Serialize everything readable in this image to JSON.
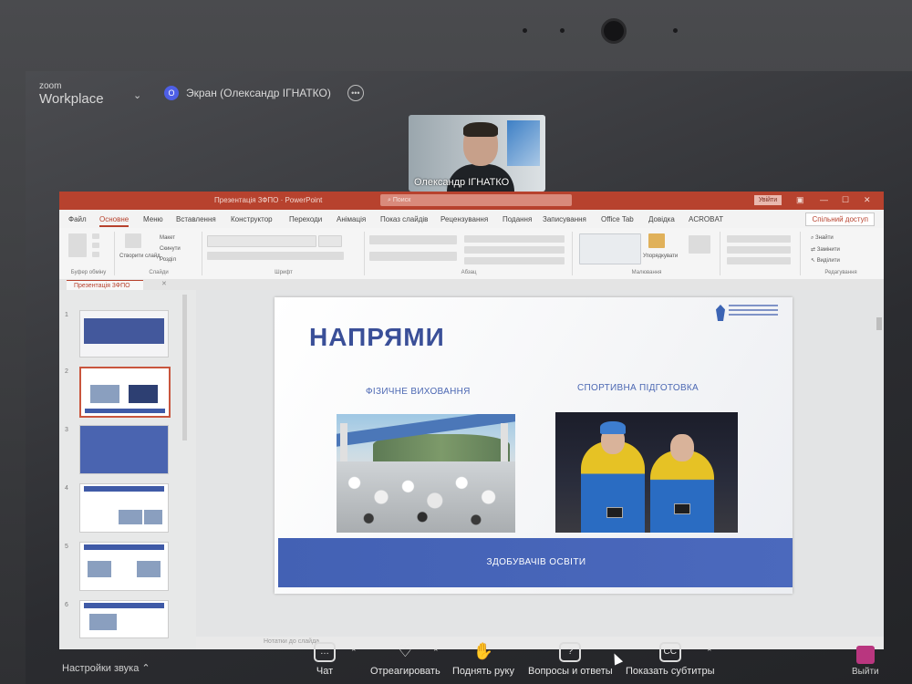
{
  "zoom": {
    "brand_small": "zoom",
    "brand_big": "Workplace",
    "share_icon": "О",
    "share_label": "Экран (Олександр ІГНАТКО)",
    "participant_name": "Олександр ІГНАТКО",
    "toolbar": {
      "audio_settings": "Настройки звука",
      "chat": "Чат",
      "react": "Отреагировать",
      "raise_hand": "Поднять руку",
      "qa": "Вопросы и ответы",
      "captions": "Показать субтитры",
      "captions_icon": "CC",
      "leave": "Выйти"
    }
  },
  "ppt": {
    "window_title": "Презентація 3ФПО · PowerPoint",
    "search_placeholder": "Поиск",
    "signin": "Увійти",
    "tabs": [
      "Файл",
      "Основне",
      "Меню",
      "Вставлення",
      "Конструктор",
      "Переходи",
      "Анімація",
      "Показ слайдів",
      "Рецензування",
      "Подання",
      "Записування",
      "Office Tab",
      "Довідка",
      "ACROBAT"
    ],
    "active_tab_index": 1,
    "share_access": "Спільний доступ",
    "ribbon_groups": [
      "Буфер обміну",
      "Слайди",
      "Шрифт",
      "Абзац",
      "Малювання",
      "Редагування"
    ],
    "ribbon_items": {
      "new_slide": "Створити слайд",
      "layout": "Макет",
      "reset": "Скинути",
      "sections": "Розділ",
      "arrange": "Упорядкувати",
      "find": "Знайти",
      "replace": "Замінити",
      "select": "Виділити"
    },
    "doc_tab": "Презентація 3ФПО",
    "slide_numbers": [
      "1",
      "2",
      "3",
      "4",
      "5",
      "6"
    ],
    "notes_placeholder": "Нотатки до слайда",
    "slide": {
      "title": "НАПРЯМИ",
      "left_caption": "ФІЗИЧНЕ ВИХОВАННЯ",
      "right_caption": "СПОРТИВНА ПІДГОТОВКА",
      "banner": "ЗДОБУВАЧІВ ОСВІТИ"
    }
  },
  "colors": {
    "ppt_accent": "#b7422e",
    "slide_blue": "#3a4f98",
    "banner_blue": "#4361b4",
    "zoom_leave": "#b9367f"
  }
}
